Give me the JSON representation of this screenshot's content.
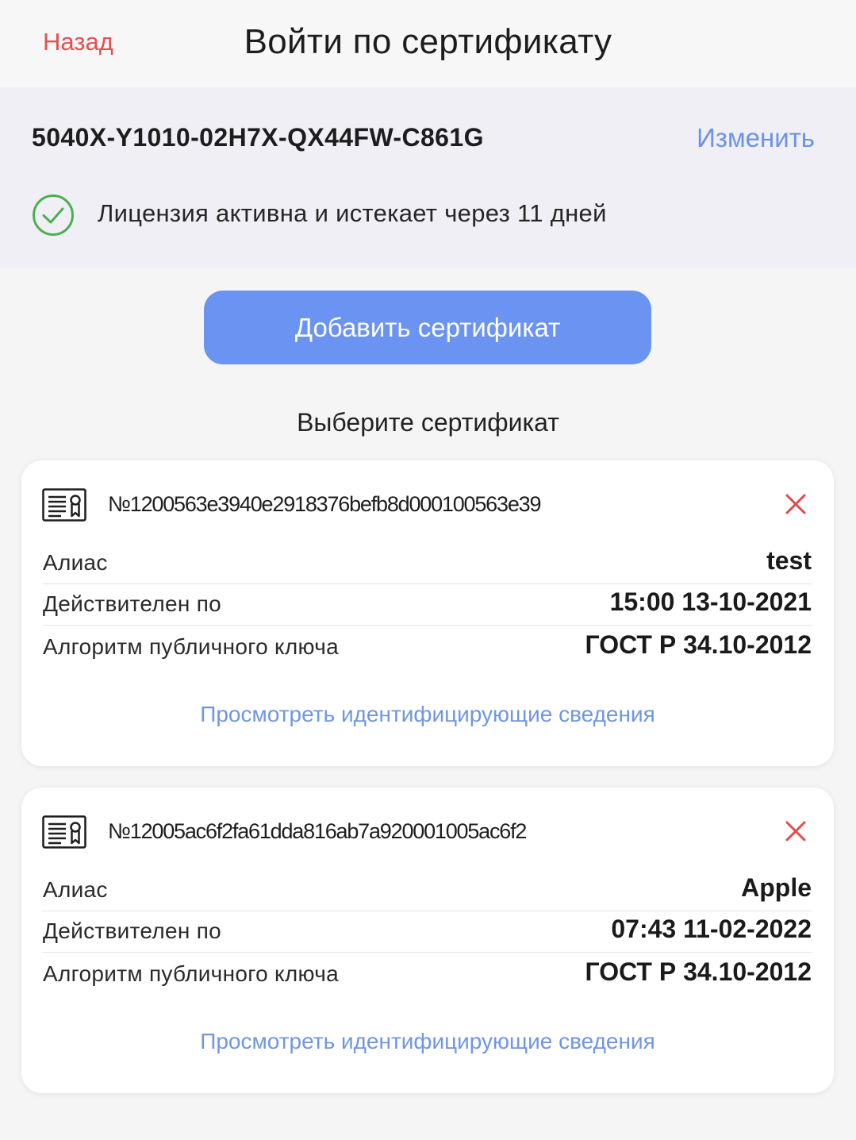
{
  "header": {
    "back_label": "Назад",
    "title": "Войти по сертификату"
  },
  "license": {
    "key": "5040X-Y1010-02H7X-QX44FW-C861G",
    "change_label": "Изменить",
    "status_text": "Лицензия активна и истекает через 11 дней",
    "status_icon": "check-circle-icon"
  },
  "add_button_label": "Добавить сертификат",
  "select_heading": "Выберите сертификат",
  "colors": {
    "accent": "#6b93f2",
    "link": "#6f96e3",
    "danger": "#e45050",
    "success": "#4caf50"
  },
  "certificates": [
    {
      "number": "№1200563e3940e2918376befb8d000100563e39",
      "alias_label": "Алиас",
      "alias": "test",
      "valid_label": "Действителен по",
      "valid_until": "15:00 13-10-2021",
      "algo_label": "Алгоритм публичного ключа",
      "algorithm": "ГОСТ Р 34.10-2012",
      "details_label": "Просмотреть идентифицирующие сведения"
    },
    {
      "number": "№12005ac6f2fa61dda816ab7a920001005ac6f2",
      "alias_label": "Алиас",
      "alias": "Apple",
      "valid_label": "Действителен по",
      "valid_until": "07:43 11-02-2022",
      "algo_label": "Алгоритм публичного ключа",
      "algorithm": "ГОСТ Р 34.10-2012",
      "details_label": "Просмотреть идентифицирующие сведения"
    }
  ]
}
